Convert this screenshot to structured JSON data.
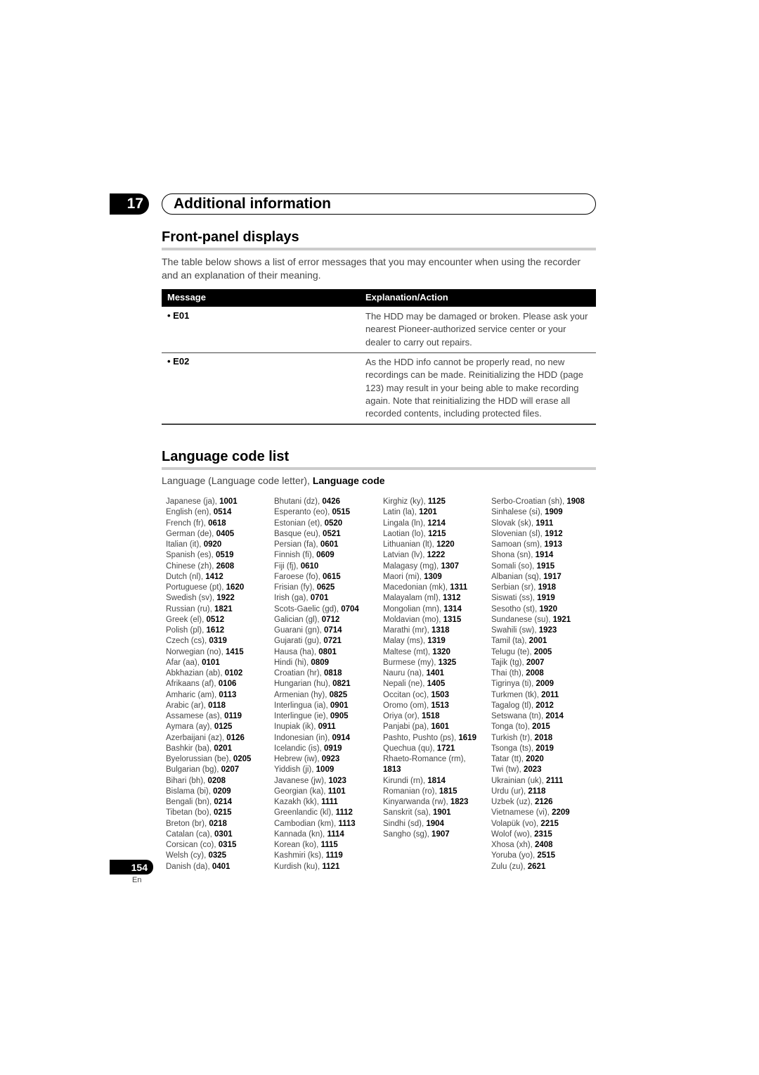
{
  "chapter": {
    "number": "17",
    "title": "Additional information"
  },
  "front_panel": {
    "title": "Front-panel displays",
    "intro": "The table below shows a list of error messages that you may encounter when using the recorder and an explanation of their meaning.",
    "table": {
      "headers": [
        "Message",
        "Explanation/Action"
      ],
      "rows": [
        {
          "message": "• E01",
          "explanation": "The HDD may be damaged or broken. Please ask your nearest Pioneer-authorized service center or your dealer to carry out repairs."
        },
        {
          "message": "• E02",
          "explanation": "As the HDD info cannot be properly read, no new recordings can be made. Reinitializing the HDD (page 123) may result in your being able to make recording again. Note that reinitializing the HDD will erase all recorded contents, including protected files."
        }
      ]
    }
  },
  "language_list": {
    "title": "Language code list",
    "caption_plain": "Language (Language code letter), ",
    "caption_bold": "Language code",
    "columns": [
      [
        [
          "Japanese (ja), ",
          "1001"
        ],
        [
          "English (en), ",
          "0514"
        ],
        [
          "French (fr), ",
          "0618"
        ],
        [
          "German (de), ",
          "0405"
        ],
        [
          "Italian (it), ",
          "0920"
        ],
        [
          "Spanish (es), ",
          "0519"
        ],
        [
          "Chinese (zh), ",
          "2608"
        ],
        [
          "Dutch (nl), ",
          "1412"
        ],
        [
          "Portuguese (pt), ",
          "1620"
        ],
        [
          "Swedish (sv), ",
          "1922"
        ],
        [
          "Russian (ru), ",
          "1821"
        ],
        [
          "Greek (el), ",
          "0512"
        ],
        [
          "Polish (pl), ",
          "1612"
        ],
        [
          "Czech (cs), ",
          "0319"
        ],
        [
          "Norwegian (no), ",
          "1415"
        ],
        [
          "Afar (aa), ",
          "0101"
        ],
        [
          "Abkhazian (ab), ",
          "0102"
        ],
        [
          "Afrikaans (af), ",
          "0106"
        ],
        [
          "Amharic (am), ",
          "0113"
        ],
        [
          "Arabic (ar), ",
          "0118"
        ],
        [
          "Assamese (as), ",
          "0119"
        ],
        [
          "Aymara (ay), ",
          "0125"
        ],
        [
          "Azerbaijani (az), ",
          "0126"
        ],
        [
          "Bashkir (ba), ",
          "0201"
        ],
        [
          "Byelorussian (be), ",
          "0205"
        ],
        [
          "Bulgarian (bg), ",
          "0207"
        ],
        [
          "Bihari (bh), ",
          "0208"
        ],
        [
          "Bislama (bi), ",
          "0209"
        ],
        [
          "Bengali (bn), ",
          "0214"
        ],
        [
          "Tibetan (bo), ",
          "0215"
        ],
        [
          "Breton (br), ",
          "0218"
        ],
        [
          "Catalan (ca), ",
          "0301"
        ],
        [
          "Corsican (co), ",
          "0315"
        ],
        [
          "Welsh (cy), ",
          "0325"
        ],
        [
          "Danish (da), ",
          "0401"
        ]
      ],
      [
        [
          "Bhutani (dz), ",
          "0426"
        ],
        [
          "Esperanto (eo), ",
          "0515"
        ],
        [
          "Estonian (et), ",
          "0520"
        ],
        [
          "Basque (eu), ",
          "0521"
        ],
        [
          "Persian (fa), ",
          "0601"
        ],
        [
          "Finnish (fi), ",
          "0609"
        ],
        [
          "Fiji (fj), ",
          "0610"
        ],
        [
          "Faroese (fo), ",
          "0615"
        ],
        [
          "Frisian (fy), ",
          "0625"
        ],
        [
          "Irish (ga), ",
          "0701"
        ],
        [
          "Scots-Gaelic (gd), ",
          "0704"
        ],
        [
          "Galician (gl), ",
          "0712"
        ],
        [
          "Guarani (gn), ",
          "0714"
        ],
        [
          "Gujarati (gu), ",
          "0721"
        ],
        [
          "Hausa (ha), ",
          "0801"
        ],
        [
          "Hindi (hi), ",
          "0809"
        ],
        [
          "Croatian (hr), ",
          "0818"
        ],
        [
          "Hungarian (hu), ",
          "0821"
        ],
        [
          "Armenian (hy), ",
          "0825"
        ],
        [
          "Interlingua (ia), ",
          "0901"
        ],
        [
          "Interlingue (ie), ",
          "0905"
        ],
        [
          "Inupiak (ik), ",
          "0911"
        ],
        [
          "Indonesian (in), ",
          "0914"
        ],
        [
          "Icelandic (is), ",
          "0919"
        ],
        [
          "Hebrew (iw), ",
          "0923"
        ],
        [
          "Yiddish (ji), ",
          "1009"
        ],
        [
          "Javanese (jw), ",
          "1023"
        ],
        [
          "Georgian (ka), ",
          "1101"
        ],
        [
          "Kazakh (kk), ",
          "1111"
        ],
        [
          "Greenlandic (kl), ",
          "1112"
        ],
        [
          "Cambodian (km), ",
          "1113"
        ],
        [
          "Kannada (kn), ",
          "1114"
        ],
        [
          "Korean (ko), ",
          "1115"
        ],
        [
          "Kashmiri (ks), ",
          "1119"
        ],
        [
          "Kurdish (ku), ",
          "1121"
        ]
      ],
      [
        [
          "Kirghiz (ky), ",
          "1125"
        ],
        [
          "Latin (la), ",
          "1201"
        ],
        [
          "Lingala (ln), ",
          "1214"
        ],
        [
          "Laotian (lo), ",
          "1215"
        ],
        [
          "Lithuanian (lt), ",
          "1220"
        ],
        [
          "Latvian (lv), ",
          "1222"
        ],
        [
          "Malagasy (mg), ",
          "1307"
        ],
        [
          "Maori (mi), ",
          "1309"
        ],
        [
          "Macedonian (mk), ",
          "1311"
        ],
        [
          "Malayalam (ml), ",
          "1312"
        ],
        [
          "Mongolian (mn), ",
          "1314"
        ],
        [
          "Moldavian (mo), ",
          "1315"
        ],
        [
          "Marathi (mr), ",
          "1318"
        ],
        [
          "Malay (ms), ",
          "1319"
        ],
        [
          "Maltese (mt), ",
          "1320"
        ],
        [
          "Burmese (my), ",
          "1325"
        ],
        [
          "Nauru (na), ",
          "1401"
        ],
        [
          "Nepali (ne), ",
          "1405"
        ],
        [
          "Occitan (oc), ",
          "1503"
        ],
        [
          "Oromo (om), ",
          "1513"
        ],
        [
          "Oriya (or), ",
          "1518"
        ],
        [
          "Panjabi (pa), ",
          "1601"
        ],
        [
          "Pashto, Pushto (ps), ",
          "1619"
        ],
        [
          "Quechua (qu), ",
          "1721"
        ],
        [
          "Rhaeto-Romance (rm), ",
          ""
        ],
        [
          "",
          "1813"
        ],
        [
          "Kirundi (rn), ",
          "1814"
        ],
        [
          "Romanian (ro), ",
          "1815"
        ],
        [
          "Kinyarwanda (rw), ",
          "1823"
        ],
        [
          "Sanskrit (sa), ",
          "1901"
        ],
        [
          "Sindhi (sd), ",
          "1904"
        ],
        [
          "Sangho (sg), ",
          "1907"
        ]
      ],
      [
        [
          "Serbo-Croatian (sh), ",
          "1908"
        ],
        [
          "Sinhalese (si), ",
          "1909"
        ],
        [
          "Slovak (sk), ",
          "1911"
        ],
        [
          "Slovenian (sl), ",
          "1912"
        ],
        [
          "Samoan (sm), ",
          "1913"
        ],
        [
          "Shona (sn), ",
          "1914"
        ],
        [
          "Somali (so), ",
          "1915"
        ],
        [
          "Albanian (sq), ",
          "1917"
        ],
        [
          "Serbian (sr), ",
          "1918"
        ],
        [
          "Siswati (ss), ",
          "1919"
        ],
        [
          "Sesotho (st), ",
          "1920"
        ],
        [
          "Sundanese (su), ",
          "1921"
        ],
        [
          "Swahili (sw), ",
          "1923"
        ],
        [
          "Tamil (ta), ",
          "2001"
        ],
        [
          "Telugu (te), ",
          "2005"
        ],
        [
          "Tajik (tg), ",
          "2007"
        ],
        [
          "Thai (th), ",
          "2008"
        ],
        [
          "Tigrinya (ti), ",
          "2009"
        ],
        [
          "Turkmen (tk), ",
          "2011"
        ],
        [
          "Tagalog (tl), ",
          "2012"
        ],
        [
          "Setswana (tn), ",
          "2014"
        ],
        [
          "Tonga (to), ",
          "2015"
        ],
        [
          "Turkish (tr), ",
          "2018"
        ],
        [
          "Tsonga (ts), ",
          "2019"
        ],
        [
          "Tatar (tt), ",
          "2020"
        ],
        [
          "Twi (tw), ",
          "2023"
        ],
        [
          "Ukrainian (uk), ",
          "2111"
        ],
        [
          "Urdu (ur), ",
          "2118"
        ],
        [
          "Uzbek (uz), ",
          "2126"
        ],
        [
          "Vietnamese (vi), ",
          "2209"
        ],
        [
          "Volapük (vo), ",
          "2215"
        ],
        [
          "Wolof (wo), ",
          "2315"
        ],
        [
          "Xhosa (xh), ",
          "2408"
        ],
        [
          "Yoruba (yo), ",
          "2515"
        ],
        [
          "Zulu (zu), ",
          "2621"
        ]
      ]
    ]
  },
  "footer": {
    "page_number": "154",
    "language": "En"
  }
}
